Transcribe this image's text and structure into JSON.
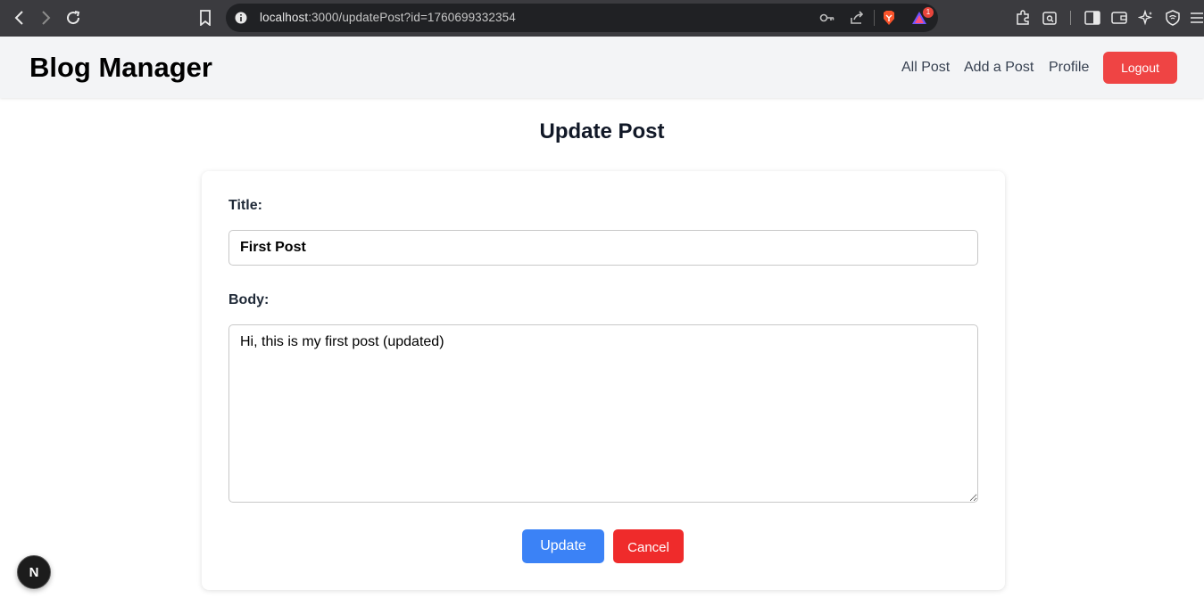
{
  "browser": {
    "url_host": "localhost",
    "url_rest": ":3000/updatePost?id=1760699332354",
    "extension_badge": "1"
  },
  "header": {
    "brand": "Blog Manager",
    "nav": [
      "All Post",
      "Add a Post",
      "Profile"
    ],
    "logout_label": "Logout"
  },
  "page": {
    "title": "Update Post"
  },
  "form": {
    "title_label": "Title:",
    "title_value": "First Post",
    "body_label": "Body:",
    "body_value": "Hi, this is my first post (updated)",
    "update_label": "Update",
    "cancel_label": "Cancel"
  },
  "dev_indicator": "N",
  "colors": {
    "logout": "#ef4444",
    "update": "#3b82f6",
    "cancel": "#ef2b2b",
    "header_bg": "#f3f4f6"
  }
}
